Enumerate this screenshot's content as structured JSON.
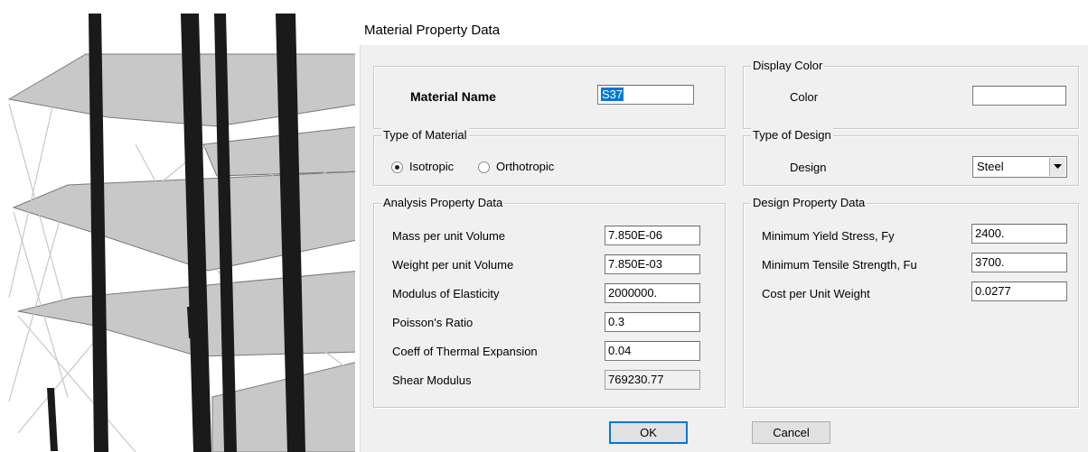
{
  "dialog": {
    "title": "Material Property Data",
    "ok_label": "OK",
    "cancel_label": "Cancel"
  },
  "material_name": {
    "label": "Material Name",
    "value": "S37"
  },
  "display_color": {
    "legend": "Display Color",
    "label": "Color",
    "swatch_color": "#ffffff"
  },
  "type_of_material": {
    "legend": "Type of Material",
    "options": [
      {
        "label": "Isotropic",
        "selected": true
      },
      {
        "label": "Orthotropic",
        "selected": false
      }
    ]
  },
  "type_of_design": {
    "legend": "Type of Design",
    "label": "Design",
    "value": "Steel"
  },
  "analysis": {
    "legend": "Analysis Property Data",
    "rows": [
      {
        "label": "Mass per unit Volume",
        "value": "7.850E-06"
      },
      {
        "label": "Weight per unit Volume",
        "value": "7.850E-03"
      },
      {
        "label": "Modulus of Elasticity",
        "value": "2000000."
      },
      {
        "label": "Poisson's Ratio",
        "value": "0.3"
      },
      {
        "label": "Coeff of Thermal Expansion",
        "value": "0.04"
      },
      {
        "label": "Shear Modulus",
        "value": "769230.77"
      }
    ]
  },
  "design": {
    "legend": "Design Property Data",
    "rows": [
      {
        "label": "Minimum Yield Stress, Fy",
        "value": "2400."
      },
      {
        "label": "Minimum Tensile Strength, Fu",
        "value": "3700."
      },
      {
        "label": "Cost per Unit Weight",
        "value": "0.0277"
      }
    ]
  },
  "colors": {
    "accent": "#0078d7",
    "dialog_bg": "#f0f0f0"
  }
}
